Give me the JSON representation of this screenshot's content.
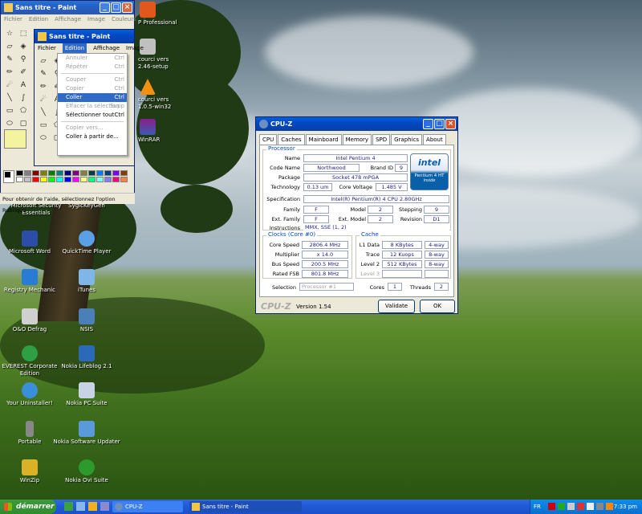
{
  "desktop": {
    "icons_left": [
      {
        "label": "Microsoft Security Essentials",
        "icon": "shield-icon"
      },
      {
        "label": "Microsoft Word",
        "icon": "word-icon"
      },
      {
        "label": "Registry Mechanic",
        "icon": "registry-icon"
      },
      {
        "label": "O&O Defrag",
        "icon": "defrag-icon"
      },
      {
        "label": "EVEREST Corporate Edition",
        "icon": "everest-icon"
      },
      {
        "label": "Your Uninstaller!",
        "icon": "uninstaller-icon"
      },
      {
        "label": "Portable",
        "icon": "portable-icon"
      },
      {
        "label": "WinZip",
        "icon": "winzip-icon"
      }
    ],
    "icons_right": [
      {
        "label": "SygicKeyGen",
        "icon": "keygen-icon"
      },
      {
        "label": "QuickTime Player",
        "icon": "quicktime-icon"
      },
      {
        "label": "iTunes",
        "icon": "itunes-icon"
      },
      {
        "label": "NSIS",
        "icon": "nsis-icon"
      },
      {
        "label": "Nokia Lifeblog 2.1",
        "icon": "lifeblog-icon"
      },
      {
        "label": "Nokia PC Suite",
        "icon": "pcsuite-icon"
      },
      {
        "label": "Nokia Software Updater",
        "icon": "updater-icon"
      },
      {
        "label": "Nokia Ovi Suite",
        "icon": "ovi-icon"
      }
    ],
    "partial_icons": [
      "P Professional",
      "courci vers",
      "2.46-setup",
      "courci vers",
      "1.0.5-win32",
      "WinRAR"
    ]
  },
  "paint_back": {
    "title": "Sans titre - Paint",
    "menu": [
      "Fichier",
      "Edition",
      "Affichage",
      "Image",
      "Couleurs",
      "?"
    ]
  },
  "paint_front": {
    "title": "Sans titre - Paint",
    "menu": [
      "Fichier",
      "Edition",
      "Affichage",
      "Image"
    ],
    "status": "Pour obtenir de l'aide, sélectionnez l'option Rubrique",
    "edition_menu": [
      {
        "label": "Annuler",
        "shortcut": "Ctrl",
        "state": "disabled"
      },
      {
        "label": "Répéter",
        "shortcut": "Ctrl",
        "state": "disabled"
      },
      {
        "label": "Couper",
        "shortcut": "Ctrl",
        "state": "disabled"
      },
      {
        "label": "Copier",
        "shortcut": "Ctrl",
        "state": "disabled"
      },
      {
        "label": "Coller",
        "shortcut": "Ctrl",
        "state": "highlighted"
      },
      {
        "label": "Effacer la sélection",
        "shortcut": "Supp",
        "state": "disabled"
      },
      {
        "label": "Sélectionner tout",
        "shortcut": "Ctrl",
        "state": "normal"
      },
      {
        "label": "Copier vers...",
        "shortcut": "",
        "state": "disabled"
      },
      {
        "label": "Coller à partir de...",
        "shortcut": "",
        "state": "normal"
      }
    ],
    "palette": [
      "#000000",
      "#808080",
      "#800000",
      "#808000",
      "#008000",
      "#008080",
      "#000080",
      "#800080",
      "#808040",
      "#004040",
      "#0080ff",
      "#004080",
      "#8000ff",
      "#804000",
      "#ffffff",
      "#c0c0c0",
      "#ff0000",
      "#ffff00",
      "#00ff00",
      "#00ffff",
      "#0000ff",
      "#ff00ff",
      "#ffff80",
      "#00ff80",
      "#80ffff",
      "#8080ff",
      "#ff0080",
      "#ff8040"
    ]
  },
  "cpuz": {
    "title": "CPU-Z",
    "tabs": [
      "CPU",
      "Caches",
      "Mainboard",
      "Memory",
      "SPD",
      "Graphics",
      "About"
    ],
    "processor": {
      "legend": "Processor",
      "name_label": "Name",
      "name": "Intel Pentium 4",
      "codename_label": "Code Name",
      "codename": "Northwood",
      "brandid_label": "Brand ID",
      "brandid": "9",
      "package_label": "Package",
      "package": "Socket 478 mPGA",
      "technology_label": "Technology",
      "technology": "0.13 um",
      "voltage_label": "Core Voltage",
      "voltage": "1.485 V",
      "spec_label": "Specification",
      "spec": "Intel(R) Pentium(R) 4 CPU 2.80GHz",
      "family_label": "Family",
      "family": "F",
      "model_label": "Model",
      "model": "2",
      "stepping_label": "Stepping",
      "stepping": "9",
      "extfamily_label": "Ext. Family",
      "extfamily": "F",
      "extmodel_label": "Ext. Model",
      "extmodel": "2",
      "revision_label": "Revision",
      "revision": "D1",
      "instructions_label": "Instructions",
      "instructions": "MMX, SSE (1, 2)",
      "logo_brand": "intel",
      "logo_line1": "Pentium 4 HT",
      "logo_line2": "inside"
    },
    "clocks": {
      "legend": "Clocks (Core #0)",
      "corespeed_label": "Core Speed",
      "corespeed": "2806.4 MHz",
      "multiplier_label": "Multiplier",
      "multiplier": "x 14.0",
      "busspeed_label": "Bus Speed",
      "busspeed": "200.5 MHz",
      "ratedfsb_label": "Rated FSB",
      "ratedfsb": "801.8 MHz"
    },
    "cache": {
      "legend": "Cache",
      "l1_label": "L1 Data",
      "l1": "8 KBytes",
      "l1_way": "4-way",
      "trace_label": "Trace",
      "trace": "12 Kuops",
      "trace_way": "8-way",
      "l2_label": "Level 2",
      "l2": "512 KBytes",
      "l2_way": "8-way",
      "l3_label": "Level 3"
    },
    "selection_label": "Selection",
    "selection": "Processor #1",
    "cores_label": "Cores",
    "cores": "1",
    "threads_label": "Threads",
    "threads": "2",
    "brand": "CPU-Z",
    "version": "Version 1.54",
    "validate": "Validate",
    "ok": "OK"
  },
  "taskbar": {
    "start": "démarrer",
    "tasks": [
      "CPU-Z",
      "Sans titre - Paint"
    ],
    "lang": "FR",
    "clock": "7:33 pm"
  }
}
